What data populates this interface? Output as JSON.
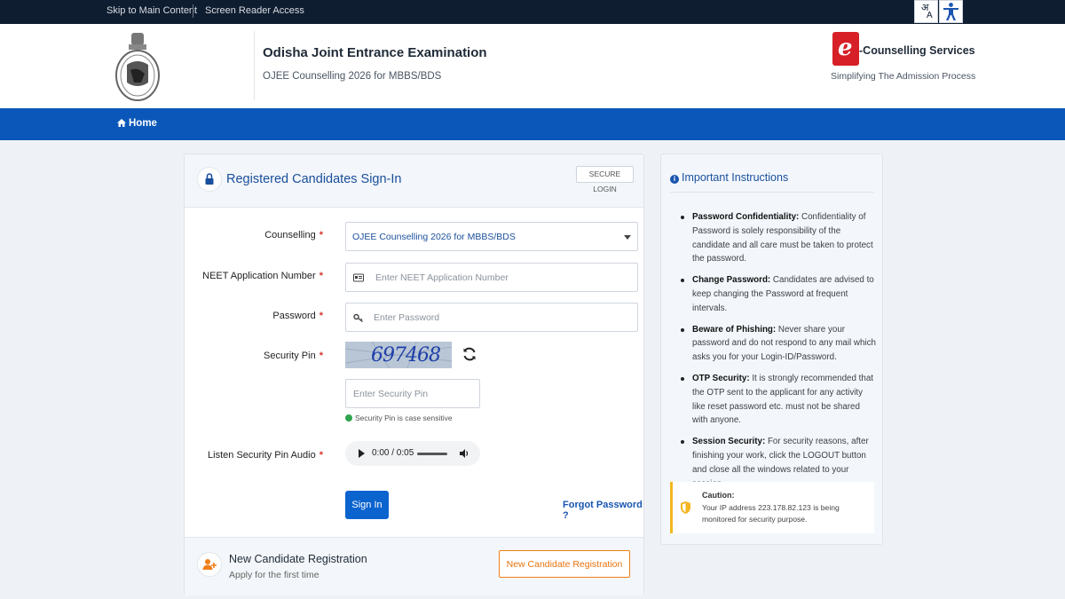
{
  "topbar": {
    "skip": "Skip to Main Content",
    "reader": "Screen Reader Access",
    "lang_glyph_top": "अ",
    "lang_glyph_bottom": "A"
  },
  "header": {
    "title": "Odisha Joint Entrance Examination",
    "subtitle": "OJEE Counselling 2026 for MBBS/BDS",
    "brand_mark": "e",
    "brand_name": "-Counselling Services",
    "brand_tagline": "Simplifying The Admission Process"
  },
  "nav": {
    "home": "Home"
  },
  "login": {
    "title": "Registered Candidates Sign-In",
    "badge": "SECURE LOGIN",
    "counselling_label": "Counselling",
    "counselling_value": "OJEE Counselling 2026 for MBBS/BDS",
    "neet_label": "NEET Application Number",
    "neet_placeholder": "Enter NEET Application Number",
    "password_label": "Password",
    "password_placeholder": "Enter Password",
    "pin_label": "Security Pin",
    "captcha_text": "697468",
    "pin_placeholder": "Enter Security Pin",
    "pin_hint": "Security Pin is case sensitive",
    "audio_label": "Listen Security Pin Audio",
    "audio_time": "0:00 / 0:05",
    "required_mark": "*",
    "signin": "Sign In",
    "forgot": "Forgot Password ?"
  },
  "registration": {
    "title": "New Candidate Registration",
    "subtitle": "Apply for the first time",
    "button": "New Candidate Registration"
  },
  "instructions": {
    "title": "Important Instructions",
    "info_glyph": "i",
    "items": [
      {
        "head": "Password Confidentiality:",
        "text": " Confidentiality of Password is solely responsibility of the candidate and all care must be taken to protect the password."
      },
      {
        "head": "Change Password:",
        "text": " Candidates are advised to keep changing the Password at frequent intervals."
      },
      {
        "head": "Beware of Phishing:",
        "text": " Never share your password and do not respond to any mail which asks you for your Login-ID/Password."
      },
      {
        "head": "OTP Security:",
        "text": " It is strongly recommended that the OTP sent to the applicant for any activity like reset password etc. must not be shared with anyone."
      },
      {
        "head": "Session Security:",
        "text": " For security reasons, after finishing your work, click the LOGOUT button and close all the windows related to your session."
      }
    ],
    "caution_title": "Caution:",
    "caution_text": "Your IP address 223.178.82.123 is being monitored for security purpose."
  },
  "colors": {
    "topbar": "#0f1d30",
    "nav": "#0b57b9",
    "primary": "#0b63ce",
    "accent_orange": "#f07f1a",
    "required": "#d9342b",
    "caution": "#f3b61f"
  }
}
